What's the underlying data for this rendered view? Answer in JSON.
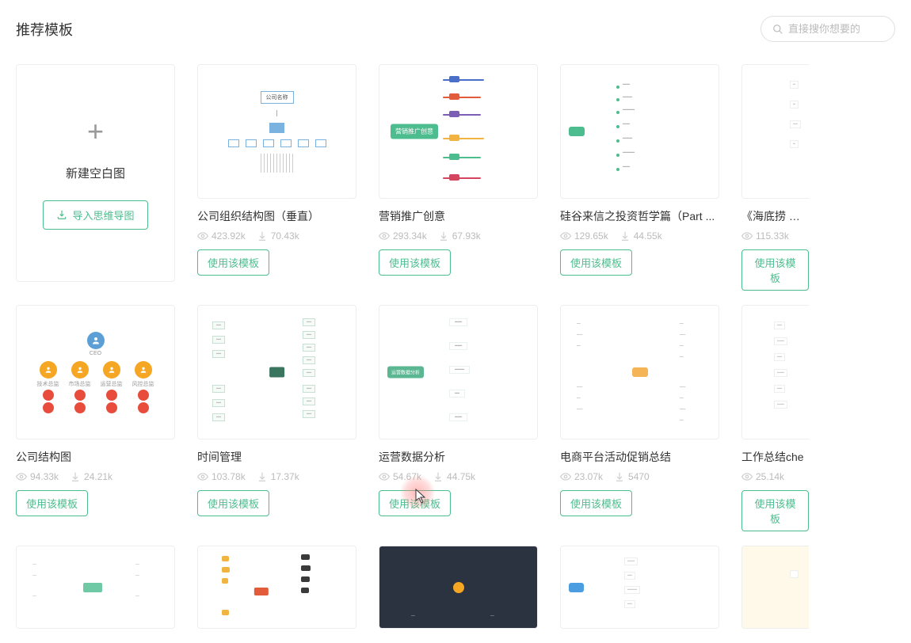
{
  "page_title": "推荐模板",
  "search": {
    "placeholder": "直接搜你想要的"
  },
  "new_card": {
    "blank_label": "新建空白图",
    "import_label": "导入思维导图"
  },
  "use_template_label": "使用该模板",
  "templates_row1": [
    {
      "title": "公司组织结构图（垂直）",
      "views": "423.92k",
      "downloads": "70.43k",
      "thumb_type": "org",
      "thumb_text": "公司名称"
    },
    {
      "title": "营销推广创意",
      "views": "293.34k",
      "downloads": "67.93k",
      "thumb_type": "mind",
      "thumb_text": "营销推广创意"
    },
    {
      "title": "硅谷来信之投资哲学篇（Part ...",
      "views": "129.65k",
      "downloads": "44.55k",
      "thumb_type": "right",
      "thumb_text": ""
    },
    {
      "title": "《海底捞 你学",
      "views": "115.33k",
      "downloads": "",
      "thumb_type": "generic",
      "thumb_text": ""
    }
  ],
  "templates_row2": [
    {
      "title": "公司结构图",
      "views": "94.33k",
      "downloads": "24.21k",
      "thumb_type": "org2",
      "thumb_text": "CEO"
    },
    {
      "title": "时间管理",
      "views": "103.78k",
      "downloads": "17.37k",
      "thumb_type": "time",
      "thumb_text": ""
    },
    {
      "title": "运营数据分析",
      "views": "54.67k",
      "downloads": "44.75k",
      "thumb_type": "right",
      "thumb_text": "运营数据分析"
    },
    {
      "title": "电商平台活动促销总结",
      "views": "23.07k",
      "downloads": "5470",
      "thumb_type": "radial",
      "thumb_text": ""
    },
    {
      "title": "工作总结che",
      "views": "25.14k",
      "downloads": "",
      "thumb_type": "generic",
      "thumb_text": ""
    }
  ],
  "templates_row3": [
    {
      "title": "",
      "thumb_type": "light"
    },
    {
      "title": "",
      "thumb_type": "orange"
    },
    {
      "title": "",
      "thumb_type": "dark"
    },
    {
      "title": "",
      "thumb_type": "blue"
    },
    {
      "title": "",
      "thumb_type": "yellow"
    }
  ],
  "thumb_labels": {
    "org_sub1": "技术总监",
    "org_sub2": "市场总监",
    "org_sub3": "运营总监",
    "org_sub4": "风控总监"
  }
}
